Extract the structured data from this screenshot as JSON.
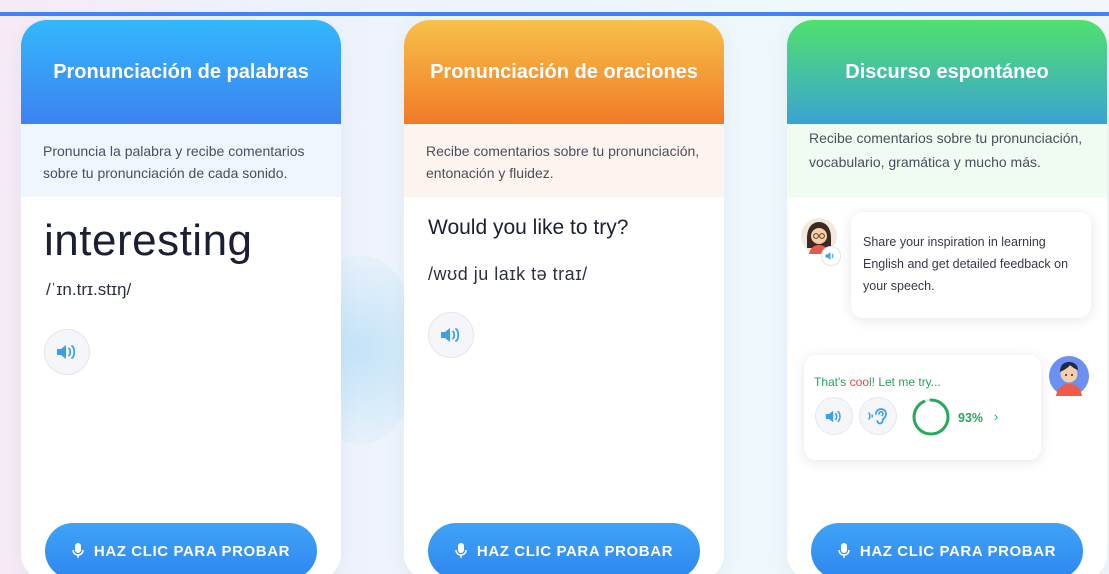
{
  "cards": [
    {
      "title": "Pronunciación de palabras",
      "description": "Pronuncia la palabra y recibe comentarios sobre tu pronunciación de cada sonido.",
      "word": "interesting",
      "ipa": "/ˈɪn.trɪ.stɪŋ/",
      "cta": "HAZ CLIC PARA PROBAR"
    },
    {
      "title": "Pronunciación de oraciones",
      "description": "Recibe comentarios sobre tu pronunciación, entonación y fluidez.",
      "sentence": "Would you like to try?",
      "ipa": "/wʊd ju laɪk tə traɪ/",
      "cta": "HAZ CLIC PARA PROBAR"
    },
    {
      "title": "Discurso espontáneo",
      "description": "Recibe comentarios sobre tu pronunciación, vocabulario, gramática y mucho más.",
      "prompt": "Share your inspiration in learning English and get detailed feedback on your speech.",
      "reply_pre": "That's ",
      "reply_highlight": "coo",
      "reply_post": "l! Let me try...",
      "score": "93%",
      "cta": "HAZ CLIC PARA PROBAR"
    }
  ],
  "icons": {
    "speaker": "speaker-icon",
    "ear": "ear-icon",
    "mic": "microphone-icon"
  },
  "colors": {
    "accent_blue": "#3d82f1",
    "accent_orange": "#f07a27",
    "accent_green": "#27a85b",
    "highlight_red": "#e9493f"
  },
  "score_fraction": 0.93
}
